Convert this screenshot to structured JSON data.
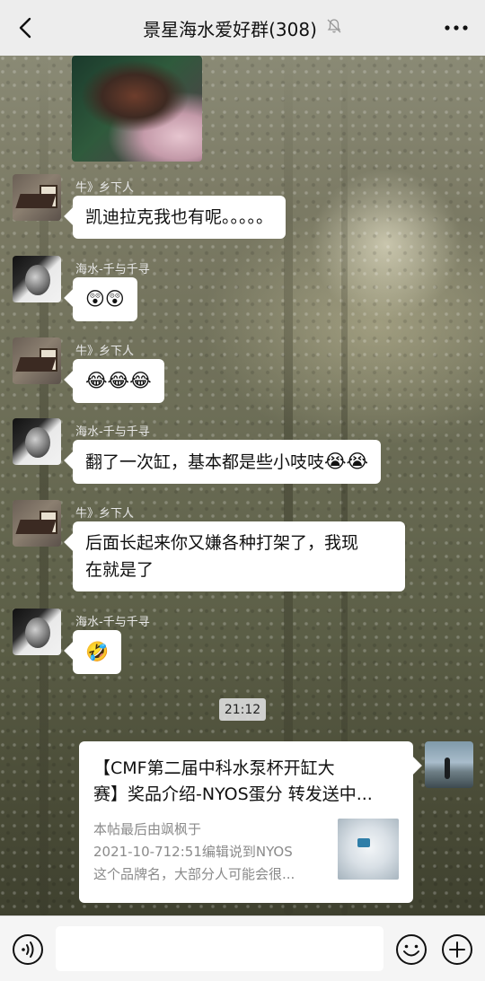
{
  "header": {
    "title": "景星海水爱好群(308)",
    "back_icon": "chevron-left-icon",
    "mute_icon": "bell-muted-icon",
    "more_icon": "more-dots-icon"
  },
  "messages": [
    {
      "sender": "牛》乡下人",
      "text": "凯迪拉克我也有呢。。。。。"
    },
    {
      "sender": "海水-千与千寻",
      "emoji": "😲😲"
    },
    {
      "sender": "牛》乡下人",
      "emoji": "😂😂😂"
    },
    {
      "sender": "海水-千与千寻",
      "text": "翻了一次缸，基本都是些小吱吱",
      "emoji": "😭😭"
    },
    {
      "sender": "牛》乡下人",
      "text_line1": "后面长起来你又嫌各种打架了，我现",
      "text_line2": "在就是了"
    },
    {
      "sender": "海水-千与千寻",
      "emoji": "🤣"
    }
  ],
  "timestamp": "21:12",
  "card": {
    "title_line1": "【CMF第二届中科水泵杯开缸大",
    "title_line2": "赛】奖品介绍-NYOS蛋分 转发送中...",
    "desc_line1": "本帖最后由飒枫于",
    "desc_line2": "2021-10-712:51编辑说到NYOS",
    "desc_line3": "这个品牌名，大部分人可能会很..."
  },
  "input_bar": {
    "voice_icon": "voice-icon",
    "emoji_icon": "emoji-icon",
    "add_icon": "plus-circle-icon"
  }
}
